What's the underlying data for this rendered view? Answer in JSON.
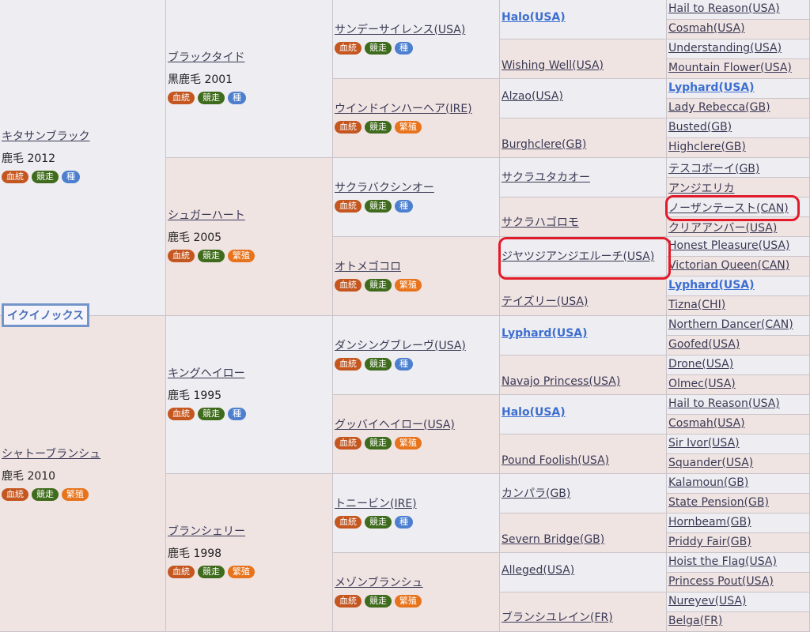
{
  "subject": {
    "name": "イクイノックス"
  },
  "sire": {
    "name": "キタサンブラック",
    "info": "鹿毛 2012",
    "badges": [
      {
        "label": "血統",
        "kind": "blood"
      },
      {
        "label": "競走",
        "kind": "race"
      },
      {
        "label": "種",
        "kind": "sire"
      }
    ],
    "sire": {
      "name": "ブラックタイド",
      "info": "黒鹿毛 2001",
      "badges": [
        {
          "label": "血統",
          "kind": "blood"
        },
        {
          "label": "競走",
          "kind": "race"
        },
        {
          "label": "種",
          "kind": "sire"
        }
      ],
      "sire": {
        "name": "サンデーサイレンス(USA)",
        "badges": [
          {
            "label": "血統",
            "kind": "blood"
          },
          {
            "label": "競走",
            "kind": "race"
          },
          {
            "label": "種",
            "kind": "sire"
          }
        ],
        "sire": {
          "name": "Halo(USA)",
          "bold": true,
          "sire": "Hail to Reason(USA)",
          "dam": "Cosmah(USA)"
        },
        "dam": {
          "name": "Wishing Well(USA)",
          "sire": "Understanding(USA)",
          "dam": "Mountain Flower(USA)"
        }
      },
      "dam": {
        "name": "ウインドインハーヘア(IRE)",
        "badges": [
          {
            "label": "血統",
            "kind": "blood"
          },
          {
            "label": "競走",
            "kind": "race"
          },
          {
            "label": "繁殖",
            "kind": "breed"
          }
        ],
        "sire": {
          "name": "Alzao(USA)",
          "sire": "Lyphard(USA)",
          "sire_bold": true,
          "dam": "Lady Rebecca(GB)"
        },
        "dam": {
          "name": "Burghclere(GB)",
          "sire": "Busted(GB)",
          "dam": "Highclere(GB)"
        }
      }
    },
    "dam": {
      "name": "シュガーハート",
      "info": "鹿毛 2005",
      "badges": [
        {
          "label": "血統",
          "kind": "blood"
        },
        {
          "label": "競走",
          "kind": "race"
        },
        {
          "label": "繁殖",
          "kind": "breed"
        }
      ],
      "sire": {
        "name": "サクラバクシンオー",
        "badges": [
          {
            "label": "血統",
            "kind": "blood"
          },
          {
            "label": "競走",
            "kind": "race"
          },
          {
            "label": "種",
            "kind": "sire"
          }
        ],
        "sire": {
          "name": "サクラユタカオー",
          "sire": "テスコボーイ(GB)",
          "dam": "アンジエリカ"
        },
        "dam": {
          "name": "サクラハゴロモ",
          "sire": "ノーザンテースト(CAN)",
          "dam": "クリアアンバー(USA)"
        }
      },
      "dam": {
        "name": "オトメゴコロ",
        "badges": [
          {
            "label": "血統",
            "kind": "blood"
          },
          {
            "label": "競走",
            "kind": "race"
          },
          {
            "label": "繁殖",
            "kind": "breed"
          }
        ],
        "sire": {
          "name": "ジヤツジアンジエルーチ(USA)",
          "sire": "Honest Pleasure(USA)",
          "dam": "Victorian Queen(CAN)"
        },
        "dam": {
          "name": "テイズリー(USA)",
          "sire": "Lyphard(USA)",
          "sire_bold": true,
          "dam": "Tizna(CHI)"
        }
      }
    }
  },
  "dam": {
    "name": "シャトーブランシュ",
    "info": "鹿毛 2010",
    "badges": [
      {
        "label": "血統",
        "kind": "blood"
      },
      {
        "label": "競走",
        "kind": "race"
      },
      {
        "label": "繁殖",
        "kind": "breed"
      }
    ],
    "sire": {
      "name": "キングヘイロー",
      "info": "鹿毛 1995",
      "badges": [
        {
          "label": "血統",
          "kind": "blood"
        },
        {
          "label": "競走",
          "kind": "race"
        },
        {
          "label": "種",
          "kind": "sire"
        }
      ],
      "sire": {
        "name": "ダンシングブレーヴ(USA)",
        "badges": [
          {
            "label": "血統",
            "kind": "blood"
          },
          {
            "label": "競走",
            "kind": "race"
          },
          {
            "label": "種",
            "kind": "sire"
          }
        ],
        "sire": {
          "name": "Lyphard(USA)",
          "bold": true,
          "sire": "Northern Dancer(CAN)",
          "dam": "Goofed(USA)"
        },
        "dam": {
          "name": "Navajo Princess(USA)",
          "sire": "Drone(USA)",
          "dam": "Olmec(USA)"
        }
      },
      "dam": {
        "name": "グッバイヘイロー(USA)",
        "badges": [
          {
            "label": "血統",
            "kind": "blood"
          },
          {
            "label": "競走",
            "kind": "race"
          },
          {
            "label": "繁殖",
            "kind": "breed"
          }
        ],
        "sire": {
          "name": "Halo(USA)",
          "bold": true,
          "sire": "Hail to Reason(USA)",
          "dam": "Cosmah(USA)"
        },
        "dam": {
          "name": "Pound Foolish(USA)",
          "sire": "Sir Ivor(USA)",
          "dam": "Squander(USA)"
        }
      }
    },
    "dam": {
      "name": "ブランシェリー",
      "info": "鹿毛 1998",
      "badges": [
        {
          "label": "血統",
          "kind": "blood"
        },
        {
          "label": "競走",
          "kind": "race"
        },
        {
          "label": "繁殖",
          "kind": "breed"
        }
      ],
      "sire": {
        "name": "トニービン(IRE)",
        "badges": [
          {
            "label": "血統",
            "kind": "blood"
          },
          {
            "label": "競走",
            "kind": "race"
          },
          {
            "label": "種",
            "kind": "sire"
          }
        ],
        "sire": {
          "name": "カンパラ(GB)",
          "sire": "Kalamoun(GB)",
          "dam": "State Pension(GB)"
        },
        "dam": {
          "name": "Severn Bridge(GB)",
          "sire": "Hornbeam(GB)",
          "dam": "Priddy Fair(GB)"
        }
      },
      "dam": {
        "name": "メゾンブランシュ",
        "badges": [
          {
            "label": "血統",
            "kind": "blood"
          },
          {
            "label": "競走",
            "kind": "race"
          },
          {
            "label": "繁殖",
            "kind": "breed"
          }
        ],
        "sire": {
          "name": "Alleged(USA)",
          "sire": "Hoist the Flag(USA)",
          "dam": "Princess Pout(USA)"
        },
        "dam": {
          "name": "ブランシユレイン(FR)",
          "sire": "Nureyev(USA)",
          "dam": "Belga(FR)"
        }
      }
    }
  }
}
